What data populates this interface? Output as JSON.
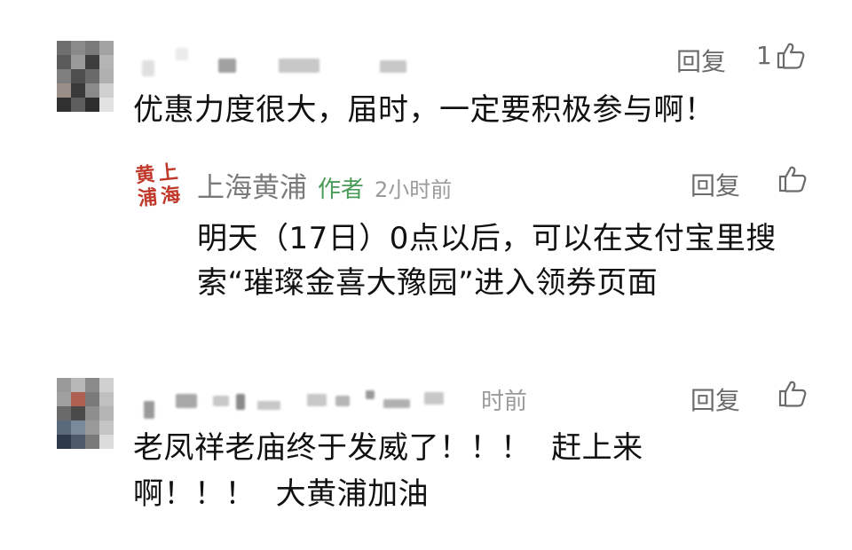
{
  "comments": [
    {
      "text": "优惠力度很大，届时，一定要积极参与啊！",
      "reply_label": "回复",
      "like_count": "1",
      "avatar_colors": [
        "#6e6e6e",
        "#8a8a8a",
        "#7a7a7a",
        "#a2a2a2",
        "#5a5a5a",
        "#9a9a9a",
        "#3e3e3e",
        "#b5b5b5",
        "#7e7e7e",
        "#4e4e4e",
        "#6a6a6a",
        "#b0b0b0",
        "#9a8f88",
        "#3a3a3a",
        "#8a8a8a",
        "#cfcfcf",
        "#303030",
        "#5e5e5e",
        "#2e2e2e",
        "#e2e2e2"
      ]
    },
    {
      "text_line1": "老凤祥老庙终于发威了！！！  赶上来",
      "text_line2": "啊！！！  大黄浦加油",
      "time_fragment": "时前",
      "reply_label": "回复",
      "avatar_colors": [
        "#9a9a9a",
        "#b8b8b8",
        "#8a8a8a",
        "#d0d0d0",
        "#a0a0a0",
        "#b06050",
        "#7a7a7a",
        "#c0c0c0",
        "#6a6a6a",
        "#4a4a4a",
        "#8e8e8e",
        "#b5b5b5",
        "#5a6a7a",
        "#7a8a9a",
        "#9a9a9a",
        "#c5c5c5",
        "#2e3a4a",
        "#4e5a6a",
        "#7a7a7a",
        "#dcdcdc"
      ]
    }
  ],
  "author_reply": {
    "name": "上海黄浦",
    "author_tag": "作者",
    "time": "2小时前",
    "reply_label": "回复",
    "text_line1": "明天（17日）0点以后，可以在支付宝里搜",
    "text_line2": "索“璀璨金喜大豫园”进入领券页面",
    "seal_chars": [
      "上",
      "黄",
      "海",
      "浦"
    ],
    "seal_color": "#c0392b"
  },
  "colors": {
    "author_tag": "#4a9a58",
    "muted": "#6b6b6b",
    "text": "#111111"
  },
  "icons": {
    "like": "thumbs-up-icon"
  }
}
